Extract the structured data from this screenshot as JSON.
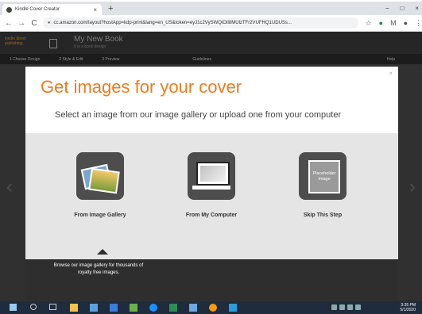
{
  "browser": {
    "tab_title": "Kindle Cover Creator",
    "tab_close": "×",
    "new_tab": "+",
    "window_controls": [
      "−",
      "□",
      "×"
    ],
    "nav": [
      "←",
      "→",
      "C"
    ],
    "url": "cc.amazon.com/layout?hostApp=kdp-print&lang=en_US&token=eyJ1c2VySWQiOiI8MUlzTFr2VUFHQ1UDUSs...",
    "toolbar_icons": [
      "star-icon",
      "extension-icon",
      "gmail-icon",
      "profile-icon",
      "menu-icon"
    ]
  },
  "app": {
    "logo_text": "kindle direct publishing",
    "book_title": "My New Book",
    "book_subtitle": "It is a book design",
    "steps": [
      "1 Choose Design",
      "2 Style & Edit",
      "3 Preview",
      "",
      "",
      "Guidelines"
    ],
    "help": "Help"
  },
  "modal": {
    "close": "×",
    "title": "Get images for your cover",
    "subtitle": "Select an image from our image gallery or upload one from your computer",
    "options": [
      {
        "label": "From Image Gallery",
        "icon": "photo-gallery-icon"
      },
      {
        "label": "From My Computer",
        "icon": "laptop-icon"
      },
      {
        "label": "Skip This Step",
        "icon": "placeholder-image-icon",
        "placeholder_text": "Placeholder Image"
      }
    ],
    "description": "Browse our image gallery for thousands of royalty free images."
  },
  "taskbar": {
    "time": "3:35 PM",
    "date": "5/1/2020"
  },
  "colors": {
    "accent_orange": "#ee7b1e",
    "taskbar": "#1f2c3d"
  }
}
